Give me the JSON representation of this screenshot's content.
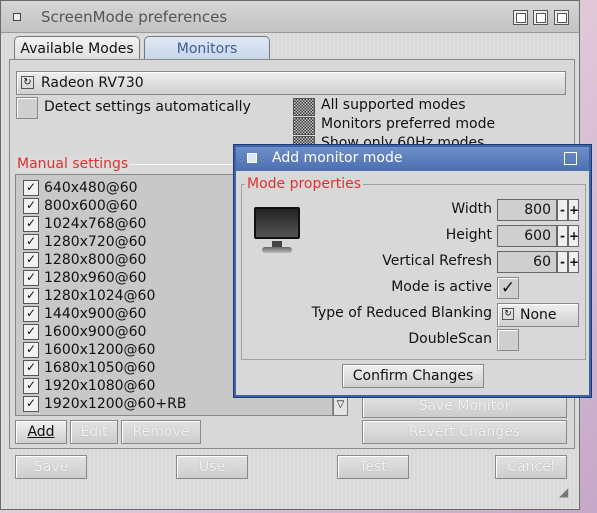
{
  "window": {
    "title": "ScreenMode preferences"
  },
  "tabs": [
    {
      "label": "Available Modes"
    },
    {
      "label": "Monitors"
    }
  ],
  "monitor": {
    "selected": "Radeon RV730"
  },
  "detect": {
    "label": "Detect settings automatically"
  },
  "filters": [
    {
      "label": "All supported modes"
    },
    {
      "label": "Monitors preferred mode"
    },
    {
      "label": "Show only 60Hz modes"
    }
  ],
  "manual": {
    "label": "Manual settings",
    "modes": [
      "640x480@60",
      "800x600@60",
      "1024x768@60",
      "1280x720@60",
      "1280x800@60",
      "1280x960@60",
      "1280x1024@60",
      "1440x900@60",
      "1600x900@60",
      "1600x1200@60",
      "1680x1050@60",
      "1920x1080@60",
      "1920x1200@60+RB"
    ]
  },
  "list_buttons": {
    "add": "Add",
    "edit": "Edit",
    "remove": "Remove"
  },
  "side_buttons": {
    "save_monitor": "Save Monitor",
    "revert": "Revert Changes"
  },
  "bottom_buttons": {
    "save": "Save",
    "use": "Use",
    "test": "Test",
    "cancel": "Cancel"
  },
  "dialog": {
    "title": "Add monitor mode",
    "section": "Mode properties",
    "width_label": "Width",
    "width": "800",
    "height_label": "Height",
    "height": "600",
    "refresh_label": "Vertical Refresh",
    "refresh": "60",
    "active_label": "Mode is active",
    "blanking_label": "Type of Reduced Blanking",
    "blanking": "None",
    "doublescan_label": "DoubleScan",
    "confirm": "Confirm Changes",
    "spin_minus": "-",
    "spin_plus": "+",
    "check_mark": "✓"
  }
}
